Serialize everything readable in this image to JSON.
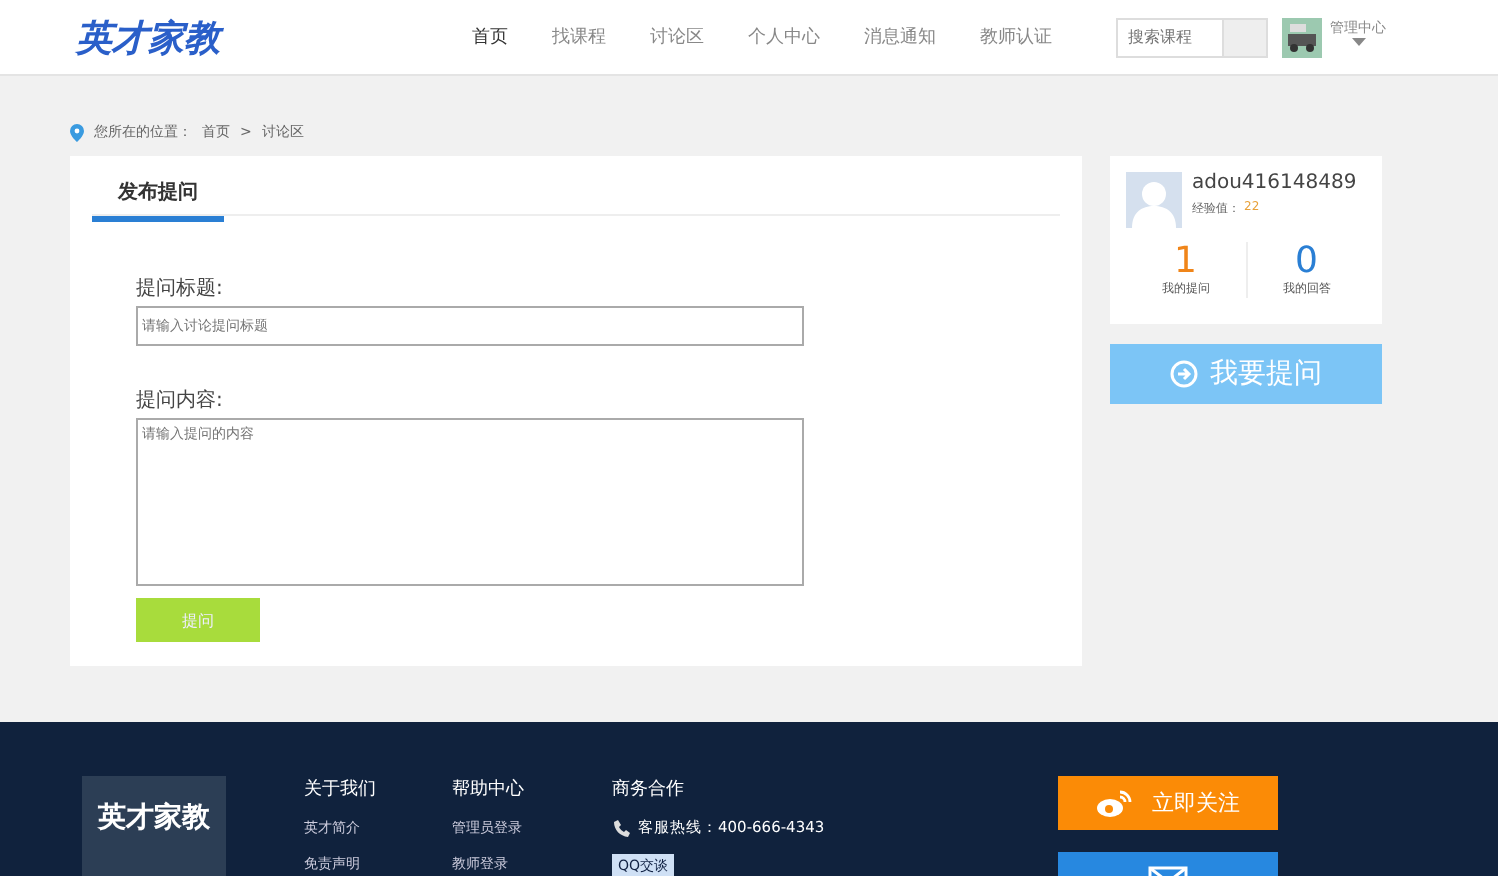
{
  "header": {
    "logo": "英才家教",
    "nav": [
      {
        "label": "首页",
        "selected": true
      },
      {
        "label": "找课程",
        "selected": false
      },
      {
        "label": "讨论区",
        "selected": false
      },
      {
        "label": "个人中心",
        "selected": false
      },
      {
        "label": "消息通知",
        "selected": false
      },
      {
        "label": "教师认证",
        "selected": false
      }
    ],
    "search": {
      "placeholder": "搜索课程"
    },
    "user_menu": "管理中心"
  },
  "breadcrumb": {
    "prefix": "您所在的位置：",
    "items": [
      "首页",
      "讨论区"
    ],
    "separator": ">"
  },
  "form": {
    "tab": {
      "label": "发布提问",
      "selected": true
    },
    "fields": [
      {
        "kind": "input",
        "label": "提问标题:",
        "placeholder": "请输入讨论提问标题"
      },
      {
        "kind": "textarea",
        "label": "提问内容:",
        "placeholder": "请输入提问的内容"
      }
    ],
    "submit": "提问"
  },
  "profile": {
    "username": "adou416148489",
    "exp_label": "经验值：",
    "exp_value": "22",
    "stats": [
      {
        "value": "1",
        "label": "我的提问",
        "color": "#f08519"
      },
      {
        "value": "0",
        "label": "我的回答",
        "color": "#2a7fd4"
      }
    ],
    "ask_button": "我要提问"
  },
  "footer": {
    "logo": "英才家教",
    "columns": [
      {
        "title": "关于我们",
        "links": [
          "英才简介",
          "免责声明"
        ]
      },
      {
        "title": "帮助中心",
        "links": [
          "管理员登录",
          "教师登录"
        ]
      }
    ],
    "contact": {
      "title": "商务合作",
      "hotline": "客服热线：400-666-4343",
      "qq": "QQ交谈"
    },
    "follow_buttons": [
      {
        "kind": "weibo",
        "label": "立即关注"
      },
      {
        "kind": "mail"
      }
    ]
  }
}
